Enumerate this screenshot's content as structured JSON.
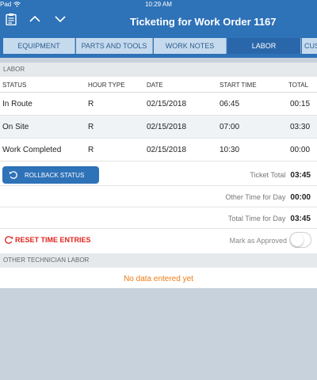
{
  "status_bar": {
    "carrier": "Pad",
    "time": "10:29 AM"
  },
  "nav": {
    "title": "Ticketing for Work Order 1167"
  },
  "tabs": [
    {
      "label": "EQUIPMENT",
      "active": false
    },
    {
      "label": "PARTS AND TOOLS",
      "active": false
    },
    {
      "label": "WORK NOTES",
      "active": false
    },
    {
      "label": "LABOR",
      "active": true
    },
    {
      "label": "CUS",
      "active": false
    }
  ],
  "labor": {
    "section_label": "LABOR",
    "columns": [
      "STATUS",
      "HOUR TYPE",
      "DATE",
      "START TIME",
      "TOTAL"
    ],
    "rows": [
      [
        "In Route",
        "R",
        "02/15/2018",
        "06:45",
        "00:15"
      ],
      [
        "On Site",
        "R",
        "02/15/2018",
        "07:00",
        "03:30"
      ],
      [
        "Work Completed",
        "R",
        "02/15/2018",
        "10:30",
        "00:00"
      ]
    ],
    "rollback_label": "ROLLBACK STATUS",
    "ticket_total_label": "Ticket Total",
    "ticket_total_value": "03:45",
    "other_time_label": "Other Time for Day",
    "other_time_value": "00:00",
    "total_time_label": "Total Time for Day",
    "total_time_value": "03:45",
    "reset_label": "RESET TIME ENTRIES",
    "mark_approved_label": "Mark as Approved",
    "mark_approved": false
  },
  "other_labor": {
    "section_label": "OTHER TECHNICIAN LABOR",
    "empty_message": "No data entered yet"
  }
}
